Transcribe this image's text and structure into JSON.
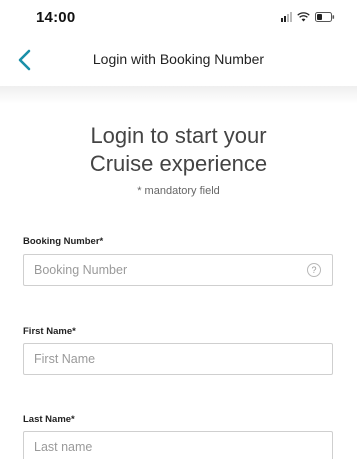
{
  "status_bar": {
    "time": "14:00",
    "icons": [
      "signal-icon",
      "wifi-icon",
      "battery-icon"
    ]
  },
  "nav": {
    "title": "Login with Booking Number",
    "back_icon": "chevron-left-icon",
    "accent_color": "#1a8fa8"
  },
  "heading": {
    "line1": "Login to start your",
    "line2": "Cruise experience",
    "mandatory_note": "* mandatory field"
  },
  "form": {
    "booking_number": {
      "label": "Booking Number*",
      "placeholder": "Booking Number",
      "value": "",
      "help_icon": "question-circle-icon",
      "help_glyph": "?"
    },
    "first_name": {
      "label": "First Name*",
      "placeholder": "First Name",
      "value": ""
    },
    "last_name": {
      "label": "Last Name*",
      "placeholder": "Last name",
      "value": ""
    }
  }
}
